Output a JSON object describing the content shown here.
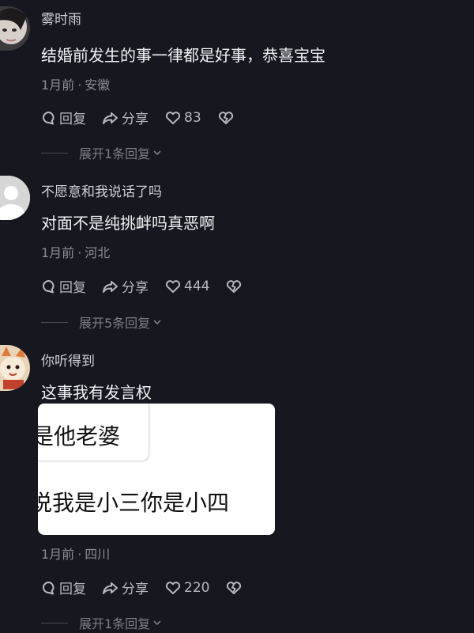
{
  "comments": [
    {
      "username": "雾时雨",
      "content": "结婚前发生的事一律都是好事，恭喜宝宝",
      "time": "1月前",
      "location": "安徽",
      "reply_label": "回复",
      "share_label": "分享",
      "likes": "83",
      "expand_label": "展开1条回复"
    },
    {
      "username": "不愿意和我说话了吗",
      "content": "对面不是纯挑衅吗真恶啊",
      "time": "1月前",
      "location": "河北",
      "reply_label": "回复",
      "share_label": "分享",
      "likes": "444",
      "expand_label": "展开5条回复"
    },
    {
      "username": "你听得到",
      "content": "这事我有发言权",
      "image_text": [
        "是他老婆",
        "说我是小三你是小四"
      ],
      "time": "1月前",
      "location": "四川",
      "reply_label": "回复",
      "share_label": "分享",
      "likes": "220",
      "expand_label": "展开1条回复"
    }
  ],
  "colors": {
    "background": "#16171f",
    "text_primary": "#f2f2f4",
    "text_secondary": "#8a8b93"
  },
  "icons": [
    "comment-icon",
    "share-icon",
    "heart-icon",
    "broken-heart-icon",
    "chevron-down-icon"
  ]
}
